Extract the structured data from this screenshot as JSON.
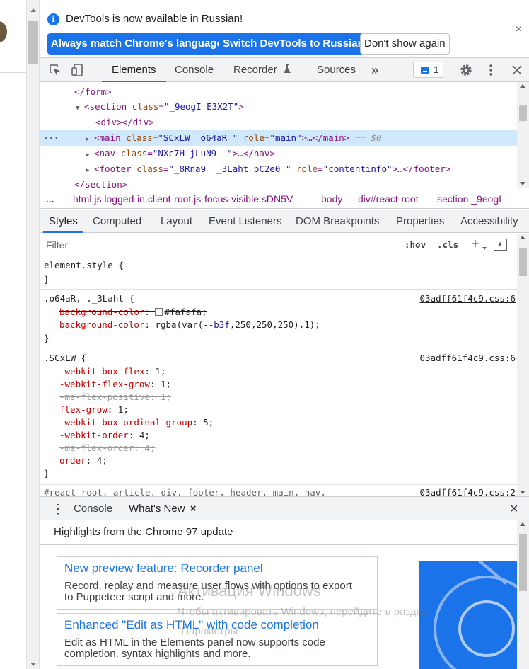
{
  "infobar": {
    "message": "DevTools is now available in Russian!",
    "btn_match": "Always match Chrome's language",
    "btn_switch": "Switch DevTools to Russian",
    "btn_dont_show": "Don't show again",
    "close": "×"
  },
  "toolbar": {
    "tabs": [
      "Elements",
      "Console",
      "Recorder",
      "Sources"
    ],
    "more": "»",
    "issues_count": "1"
  },
  "dom": {
    "l1": "</form>",
    "l2_tag": "section",
    "l2_attr": "class",
    "l2_val": "_9eogI E3X2T",
    "l3": "<div></div>",
    "l4_tag": "main",
    "l4_attr1": "class",
    "l4_val1": "SCxLW  o64aR ",
    "l4_attr2": "role",
    "l4_val2": "main",
    "l4_end": "…</main>",
    "l4_eq": "== $0",
    "l5_tag": "nav",
    "l5_attr": "class",
    "l5_val": "NXc7H jLuN9  ",
    "l5_end": "…</nav>",
    "l6_tag": "footer",
    "l6_attr1": "class",
    "l6_val1": "_8Rna9  _3Laht pC2e0 ",
    "l6_attr2": "role",
    "l6_val2": "contentinfo",
    "l6_end": "…</footer>",
    "l7": "</section>",
    "dots": "···"
  },
  "breadcrumbs": {
    "dots": "...",
    "items": [
      "html.js.logged-in.client-root.js-focus-visible.sDN5V",
      "body",
      "div#react-root",
      "section._9eogI"
    ]
  },
  "styles_tabs": [
    "Styles",
    "Computed",
    "Layout",
    "Event Listeners",
    "DOM Breakpoints",
    "Properties",
    "Accessibility"
  ],
  "filter": {
    "placeholder": "Filter",
    "hov": ":hov",
    "cls": ".cls",
    "plus": "+"
  },
  "rules": {
    "r1_selector": "element.style {",
    "close": "}",
    "r2_selector": ".o64aR, ._3Laht {",
    "r2_source": "03adff61f4c9.css:6",
    "r2_p1_name": "background-color",
    "r2_p1_val": "#fafafa;",
    "r2_p2_name": "background-color",
    "r2_p2_val_a": "rgba(var(",
    "r2_p2_var": "--b3f",
    "r2_p2_val_b": ",250,250,250),1);",
    "r3_selector": ".SCxLW {",
    "r3_source": "03adff61f4c9.css:6",
    "r3_props": [
      {
        "name": "-webkit-box-flex",
        "value": "1;"
      },
      {
        "name": "-webkit-flex-grow",
        "value": "1;"
      },
      {
        "name": "-ms-flex-positive",
        "value": "1;"
      },
      {
        "name": "flex-grow",
        "value": "1;"
      },
      {
        "name": "-webkit-box-ordinal-group",
        "value": "5;"
      },
      {
        "name": "-webkit-order",
        "value": "4;"
      },
      {
        "name": "-ms-flex-order",
        "value": "4;"
      },
      {
        "name": "order",
        "value": "4;"
      }
    ],
    "r4_selector": "#react-root, article, div, footer, header, main, nav,",
    "r4_source": "03adff61f4c9.css:2"
  },
  "drawer": {
    "menu": "⋮",
    "tabs": [
      "Console",
      "What's New"
    ],
    "tab_close": "×",
    "close": "×",
    "highlights": "Highlights from the Chrome 97 update",
    "cards": [
      {
        "title": "New preview feature: Recorder panel",
        "desc": "Record, replay and measure user flows with options to export to Puppeteer script and more."
      },
      {
        "title": "Enhanced \"Edit as HTML\" with code completion",
        "desc": "Edit as HTML in the Elements panel now supports code completion, syntax highlights and more."
      }
    ]
  },
  "watermark": {
    "title": "Активация Windows",
    "line1": "Чтобы активировать Windows, перейдите в раздел",
    "line2": "\"Параметры\"."
  },
  "colors": {
    "accent": "#1a73e8",
    "tag": "#881280",
    "attr": "#994500",
    "value": "#1a1aa6",
    "property": "#c80000"
  }
}
